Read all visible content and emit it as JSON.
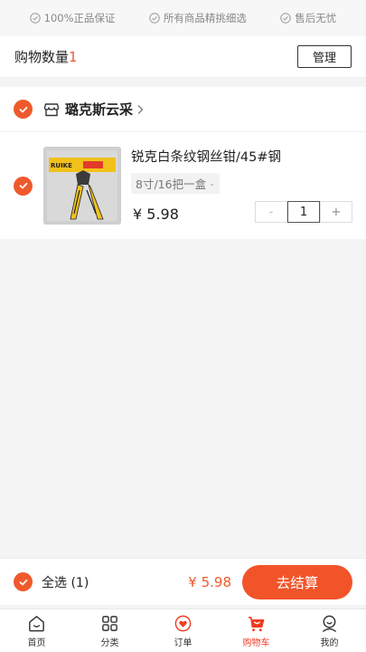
{
  "guarantees": [
    {
      "icon": "check-circle-icon",
      "text": "100%正品保证"
    },
    {
      "icon": "check-circle-icon",
      "text": "所有商品精挑细选"
    },
    {
      "icon": "check-circle-icon",
      "text": "售后无忧"
    }
  ],
  "cart_header": {
    "count_label": "购物数量",
    "count_value": "1",
    "manage_label": "管理"
  },
  "store": {
    "name": "璐克斯云采"
  },
  "product": {
    "name": "锐克白条纹钢丝钳/45#钢",
    "spec": "8寸/16把一盒",
    "price": "¥ 5.98",
    "quantity": "1",
    "minus_label": "-",
    "plus_label": "+",
    "image_brand": "RUIKE"
  },
  "checkout": {
    "select_all_label": "全选 (1)",
    "total": "¥ 5.98",
    "button_label": "去结算"
  },
  "tabs": [
    {
      "icon": "home-icon",
      "label": "首页",
      "active": false
    },
    {
      "icon": "category-icon",
      "label": "分类",
      "active": false
    },
    {
      "icon": "order-icon",
      "label": "订单",
      "active": false
    },
    {
      "icon": "cart-icon",
      "label": "购物车",
      "active": true
    },
    {
      "icon": "profile-icon",
      "label": "我的",
      "active": false
    }
  ],
  "colors": {
    "accent": "#ef5a2c",
    "checkout_button": "#f2542a",
    "tab_active": "#ef3b24"
  }
}
